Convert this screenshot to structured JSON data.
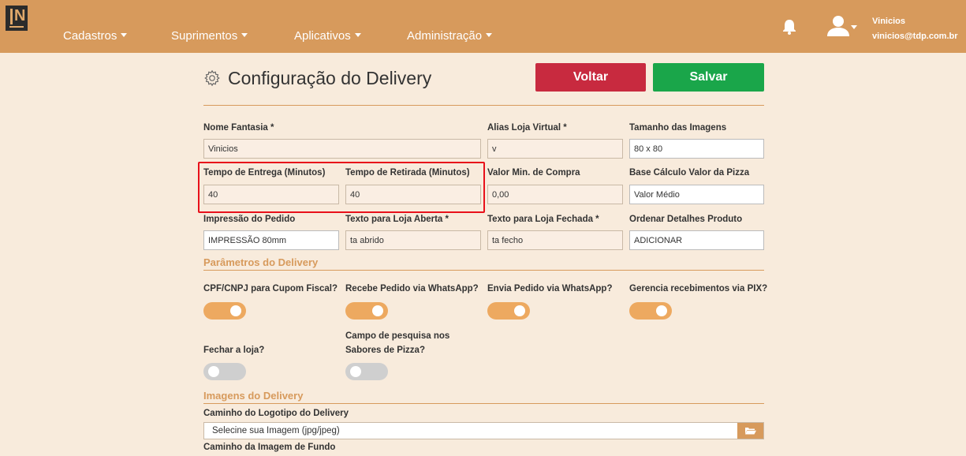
{
  "header": {
    "nav": [
      "Cadastros",
      "Suprimentos",
      "Aplicativos",
      "Administração"
    ],
    "user_name": "Vinicios",
    "user_email": "vinicios@tdp.com.br"
  },
  "page": {
    "title": "Configuração do Delivery",
    "back_label": "Voltar",
    "save_label": "Salvar"
  },
  "form": {
    "nome_fantasia": {
      "label": "Nome Fantasia *",
      "value": "Vinicios"
    },
    "alias_loja": {
      "label": "Alias Loja Virtual *",
      "value": "v"
    },
    "tamanho_imagens": {
      "label": "Tamanho das Imagens",
      "value": "80 x 80"
    },
    "tempo_entrega": {
      "label": "Tempo de Entrega (Minutos)",
      "value": "40"
    },
    "tempo_retirada": {
      "label": "Tempo de Retirada (Minutos)",
      "value": "40"
    },
    "valor_min": {
      "label": "Valor Min. de Compra",
      "value": "0,00"
    },
    "base_calculo": {
      "label": "Base Cálculo Valor da Pizza",
      "value": "Valor Médio"
    },
    "impressao": {
      "label": "Impressão do Pedido",
      "value": "IMPRESSÃO 80mm"
    },
    "texto_aberta": {
      "label": "Texto para Loja Aberta *",
      "value": "ta abrido"
    },
    "texto_fechada": {
      "label": "Texto para Loja Fechada *",
      "value": "ta fecho"
    },
    "ordenar_detalhes": {
      "label": "Ordenar Detalhes Produto",
      "value": "ADICIONAR"
    }
  },
  "parametros": {
    "section_title": "Parâmetros do Delivery",
    "cpf_cnpj": {
      "label": "CPF/CNPJ para Cupom Fiscal?",
      "on": true
    },
    "recebe_whatsapp": {
      "label": "Recebe Pedido via WhatsApp?",
      "on": true
    },
    "envia_whatsapp": {
      "label": "Envia Pedido via WhatsApp?",
      "on": true
    },
    "recebimentos_pix": {
      "label": "Gerencia recebimentos via PIX?",
      "on": true
    },
    "fechar_loja": {
      "label": "Fechar a loja?",
      "on": false
    },
    "campo_pesquisa": {
      "label_line1": "Campo de pesquisa nos",
      "label_line2": "Sabores de Pizza?",
      "on": false
    }
  },
  "imagens": {
    "section_title": "Imagens do Delivery",
    "logotipo_label": "Caminho do Logotipo do Delivery",
    "logotipo_placeholder": "Selecine sua Imagem (jpg/jpeg)",
    "fundo_label": "Caminho da Imagem de Fundo"
  },
  "colors": {
    "topbar": "#d79a5c",
    "back_button": "#c82a3f",
    "save_button": "#1aa64a",
    "toggle_on": "#eda960",
    "toggle_off": "#cfcfcf",
    "highlight": "#e8101a"
  }
}
